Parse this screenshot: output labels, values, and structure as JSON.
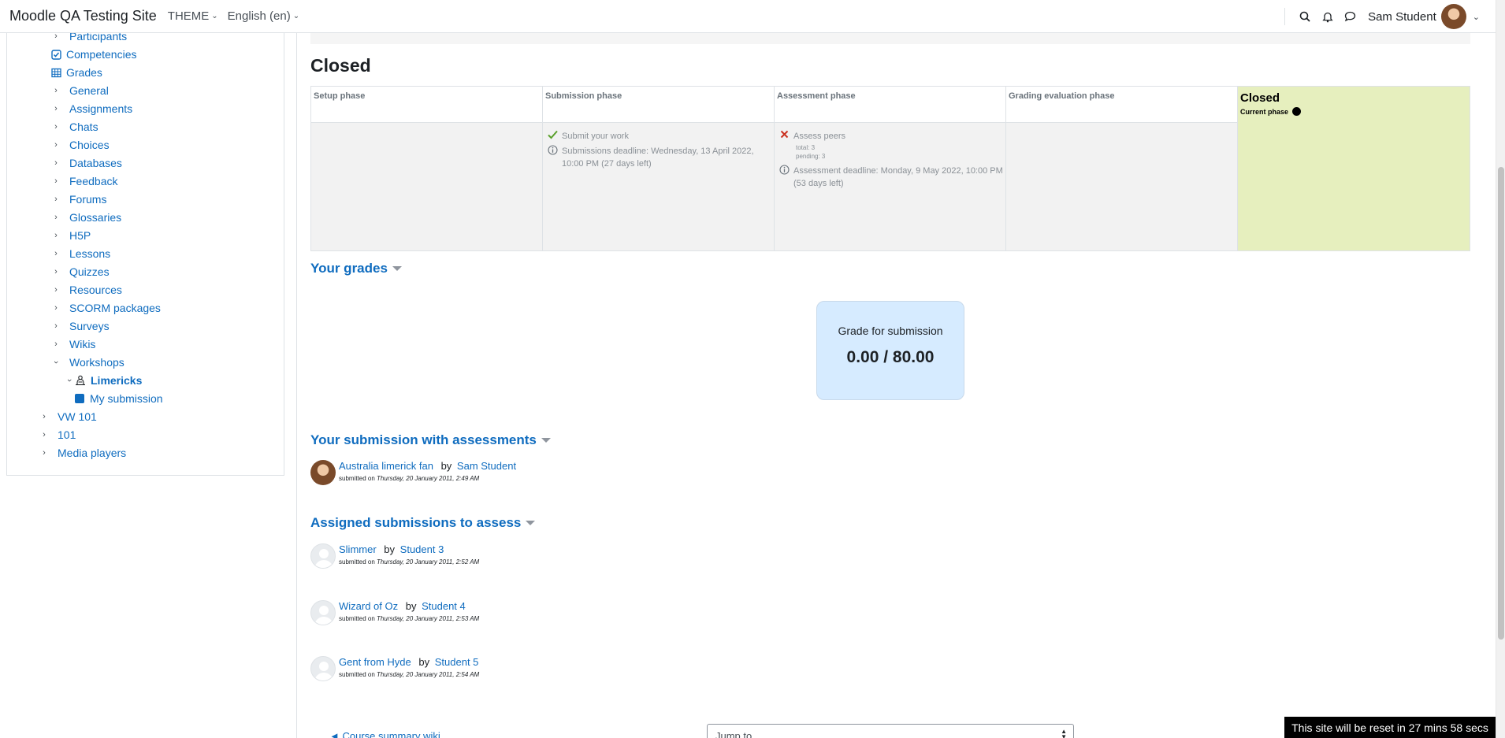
{
  "navbar": {
    "site_name": "Moodle QA Testing Site",
    "theme_label": "THEME",
    "language_label": "English (en)",
    "user_name": "Sam Student"
  },
  "sidebar": {
    "items": [
      {
        "label": "Participants",
        "icon": "chevron-right-icon"
      },
      {
        "label": "Competencies",
        "icon": "checkbox-icon"
      },
      {
        "label": "Grades",
        "icon": "table-icon"
      },
      {
        "label": "General",
        "icon": "chevron-right-icon"
      },
      {
        "label": "Assignments",
        "icon": "chevron-right-icon"
      },
      {
        "label": "Chats",
        "icon": "chevron-right-icon"
      },
      {
        "label": "Choices",
        "icon": "chevron-right-icon"
      },
      {
        "label": "Databases",
        "icon": "chevron-right-icon"
      },
      {
        "label": "Feedback",
        "icon": "chevron-right-icon"
      },
      {
        "label": "Forums",
        "icon": "chevron-right-icon"
      },
      {
        "label": "Glossaries",
        "icon": "chevron-right-icon"
      },
      {
        "label": "H5P",
        "icon": "chevron-right-icon"
      },
      {
        "label": "Lessons",
        "icon": "chevron-right-icon"
      },
      {
        "label": "Quizzes",
        "icon": "chevron-right-icon"
      },
      {
        "label": "Resources",
        "icon": "chevron-right-icon"
      },
      {
        "label": "SCORM packages",
        "icon": "chevron-right-icon"
      },
      {
        "label": "Surveys",
        "icon": "chevron-right-icon"
      },
      {
        "label": "Wikis",
        "icon": "chevron-right-icon"
      },
      {
        "label": "Workshops",
        "icon": "chevron-down-icon"
      },
      {
        "label": "Limericks",
        "icon": "workshop-icon"
      },
      {
        "label": "My submission",
        "icon": "square-icon"
      },
      {
        "label": "VW 101",
        "icon": "chevron-right-icon"
      },
      {
        "label": "101",
        "icon": "chevron-right-icon"
      },
      {
        "label": "Media players",
        "icon": "chevron-right-icon"
      }
    ]
  },
  "phase": {
    "title": "Closed",
    "columns": [
      "Setup phase",
      "Submission phase",
      "Assessment phase",
      "Grading evaluation phase",
      "Closed"
    ],
    "current_label": "Current phase",
    "submit_task": "Submit your work",
    "submissions_deadline": "Submissions deadline: Wednesday, 13 April 2022, 10:00 PM (27 days left)",
    "assess_task": "Assess peers",
    "assess_total": "total: 3",
    "assess_pending": "pending: 3",
    "assessment_deadline": "Assessment deadline: Monday, 9 May 2022, 10:00 PM (53 days left)"
  },
  "grades": {
    "heading": "Your grades",
    "label": "Grade for submission",
    "value": "0.00 / 80.00"
  },
  "your_submission": {
    "heading": "Your submission with assessments",
    "title": "Australia limerick fan",
    "by": "by",
    "author": "Sam Student",
    "submitted_prefix": "submitted on",
    "date": "Thursday, 20 January 2011, 2:49 AM"
  },
  "assigned": {
    "heading": "Assigned submissions to assess",
    "submitted_prefix": "submitted on",
    "by": "by",
    "items": [
      {
        "title": "Slimmer",
        "author": "Student 3",
        "date": "Thursday, 20 January 2011, 2:52 AM"
      },
      {
        "title": "Wizard of Oz",
        "author": "Student 4",
        "date": "Thursday, 20 January 2011, 2:53 AM"
      },
      {
        "title": "Gent from Hyde",
        "author": "Student 5",
        "date": "Thursday, 20 January 2011, 2:54 AM"
      }
    ]
  },
  "footer": {
    "prev_link": "◄ Course summary wiki",
    "jump_placeholder": "Jump to...",
    "reset_banner": "This site will be reset in 27 mins 58 secs"
  },
  "colors": {
    "link": "#0f6cbf",
    "current_phase_bg": "#e6efbe",
    "grade_box_bg": "#d6ebff"
  }
}
